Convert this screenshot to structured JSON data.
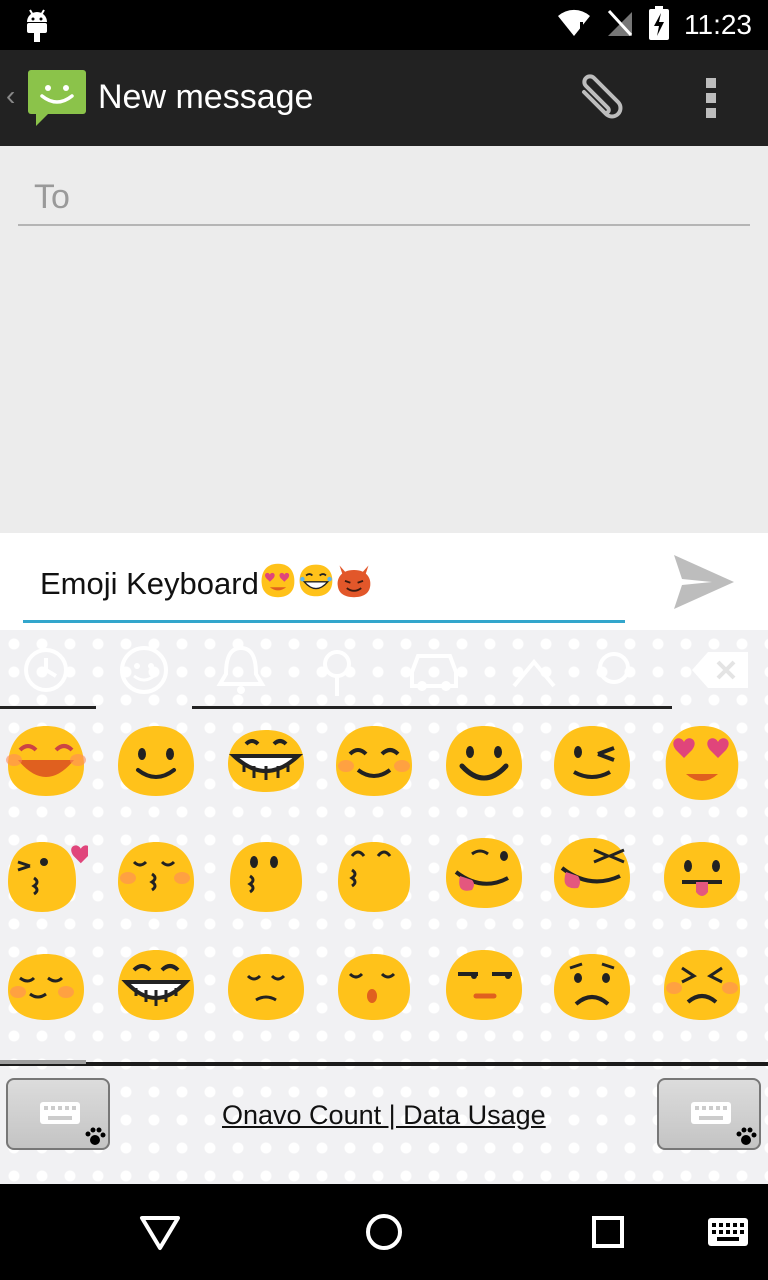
{
  "status_bar": {
    "time": "11:23",
    "icons": [
      "android-debug-icon",
      "wifi-icon",
      "no-signal-icon",
      "battery-charging-icon"
    ]
  },
  "action_bar": {
    "title": "New message",
    "icons": [
      "back-icon",
      "messaging-app-icon",
      "attach-icon",
      "overflow-menu-icon"
    ]
  },
  "recipient": {
    "placeholder": "To",
    "value": ""
  },
  "compose": {
    "text": "Emoji Keyboard",
    "inline_emoji": [
      "heart-eyes-face",
      "grinning-tears-face",
      "smiling-devil-face"
    ],
    "send_icon": "send-icon"
  },
  "keyboard": {
    "category_tabs": [
      "recent-icon",
      "smiley-icon",
      "bell-icon",
      "flower-icon",
      "car-icon",
      "symbols-icon",
      "backspace-icon"
    ],
    "selected_tab": 1,
    "emoji_rows": [
      [
        "laughing-face",
        "smiling-face",
        "grinning-face",
        "blushing-face",
        "happy-face",
        "winking-face",
        "heart-eyes-face"
      ],
      [
        "kissing-heart-face",
        "kissing-closed-eyes-face",
        "kissing-face",
        "kissing-smiling-eyes-face",
        "tongue-winking-face",
        "tongue-closed-eyes-face",
        "tongue-face"
      ],
      [
        "relieved-face",
        "big-grin-face",
        "pensive-face",
        "sleepy-kiss-face",
        "unamused-face",
        "disappointed-face",
        "persevering-face"
      ]
    ],
    "ad_text": "Onavo Count | Data Usage",
    "switch_key_icon": "keyboard-switch-icon"
  },
  "nav_bar": {
    "buttons": [
      "back-triangle-icon",
      "home-circle-icon",
      "recents-square-icon",
      "keyboard-icon"
    ]
  },
  "colors": {
    "action_bar_bg": "#222222",
    "accent_underline": "#33a6cc",
    "emoji_yellow": "#ffc21a",
    "blush": "#ff8a5c",
    "messaging_green": "#8bc34a"
  }
}
